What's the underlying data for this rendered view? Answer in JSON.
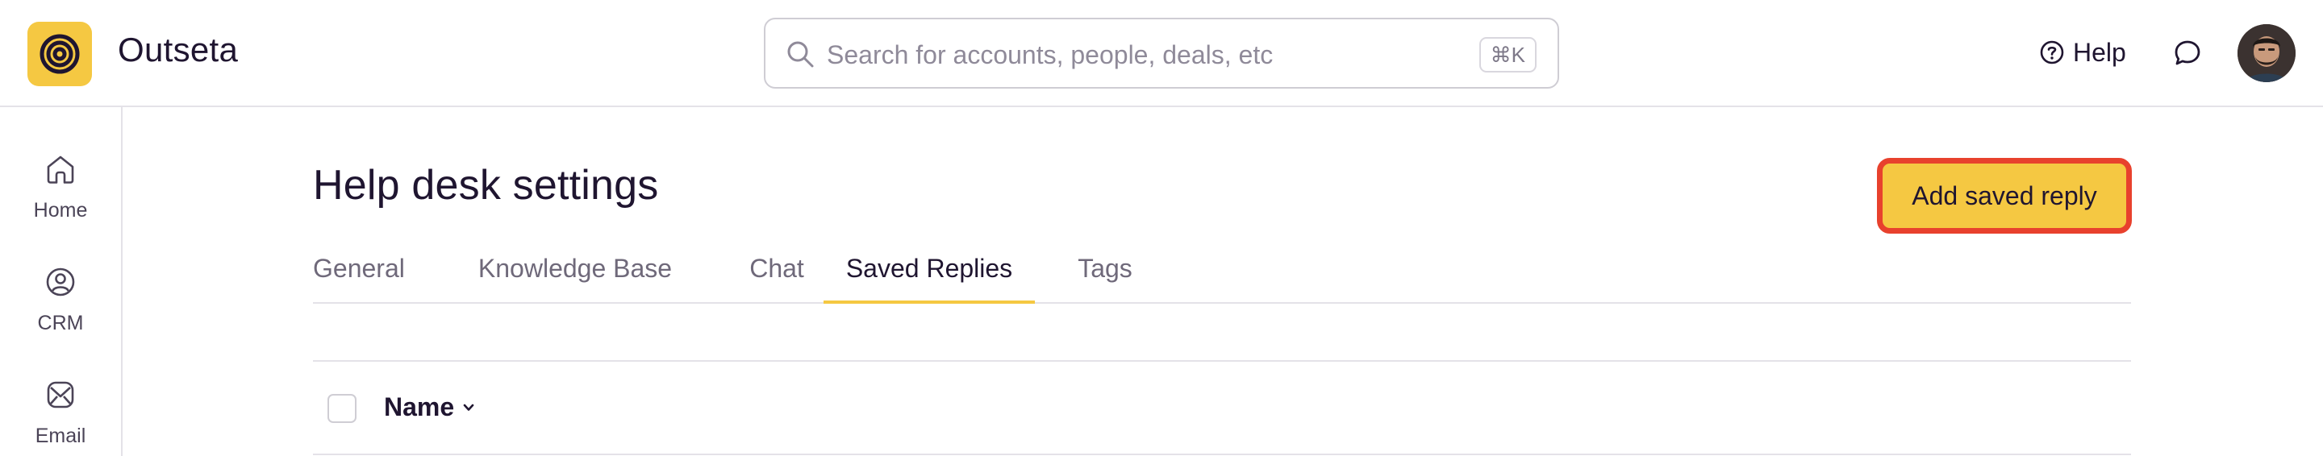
{
  "header": {
    "brand": "Outseta",
    "search": {
      "placeholder": "Search for accounts, people, deals, etc",
      "shortcut": "⌘K"
    },
    "help_label": "Help"
  },
  "sidebar": {
    "items": [
      {
        "label": "Home",
        "icon": "home-icon"
      },
      {
        "label": "CRM",
        "icon": "crm-icon"
      },
      {
        "label": "Email",
        "icon": "email-icon"
      }
    ]
  },
  "main": {
    "title": "Help desk settings",
    "add_button": "Add saved reply",
    "tabs": [
      {
        "label": "General",
        "active": false
      },
      {
        "label": "Knowledge Base",
        "active": false
      },
      {
        "label": "Chat",
        "active": false
      },
      {
        "label": "Saved Replies",
        "active": true
      },
      {
        "label": "Tags",
        "active": false
      }
    ],
    "table": {
      "columns": [
        {
          "label": "Name",
          "sortable": true
        }
      ]
    }
  },
  "colors": {
    "accent": "#f5c842",
    "highlight_border": "#e8412d",
    "text": "#1f1530",
    "muted": "#6f697a",
    "border": "#e4e2e8"
  }
}
